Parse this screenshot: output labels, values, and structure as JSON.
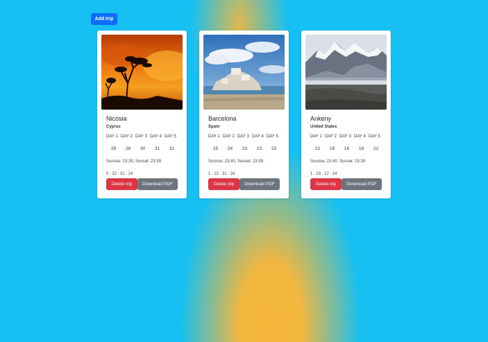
{
  "header": {
    "add_trip_label": "Add trip"
  },
  "trips": [
    {
      "city": "Nicosia",
      "country": "Cyprus",
      "days": [
        "DAY 1",
        "DAY 2",
        "DAY 3",
        "DAY 4",
        "DAY 5"
      ],
      "temps": [
        "29",
        "28",
        "30",
        "31",
        "31"
      ],
      "sun": "Sunrise: 23:39, Sunset: 23:39",
      "countdown": "0 : 22 : 31 : 24",
      "delete_label": "Delete trip",
      "pdf_label": "Download PDF"
    },
    {
      "city": "Barcelona",
      "country": "Spain",
      "days": [
        "DAY 1",
        "DAY 2",
        "DAY 3",
        "DAY 4",
        "DAY 5"
      ],
      "temps": [
        "25",
        "24",
        "23",
        "23",
        "23"
      ],
      "sun": "Sunrise: 23:40, Sunset: 23:39",
      "countdown": "1 : 22 : 31 : 24",
      "delete_label": "Delete trip",
      "pdf_label": "Download PDF"
    },
    {
      "city": "Ankeny",
      "country": "United States",
      "days": [
        "DAY 1",
        "DAY 2",
        "DAY 3",
        "DAY 4",
        "DAY 5"
      ],
      "temps": [
        "22",
        "18",
        "16",
        "18",
        "22"
      ],
      "sun": "Sunrise: 23:40, Sunset: 23:39",
      "countdown": "1 : 23 : 12 : 24",
      "delete_label": "Delete trip",
      "pdf_label": "Download PDF"
    }
  ],
  "colors": {
    "background": "#16c0f2",
    "sun_glow": "#f5b73a",
    "primary": "#0d6efd",
    "danger": "#dc3545",
    "secondary": "#6c757d"
  }
}
